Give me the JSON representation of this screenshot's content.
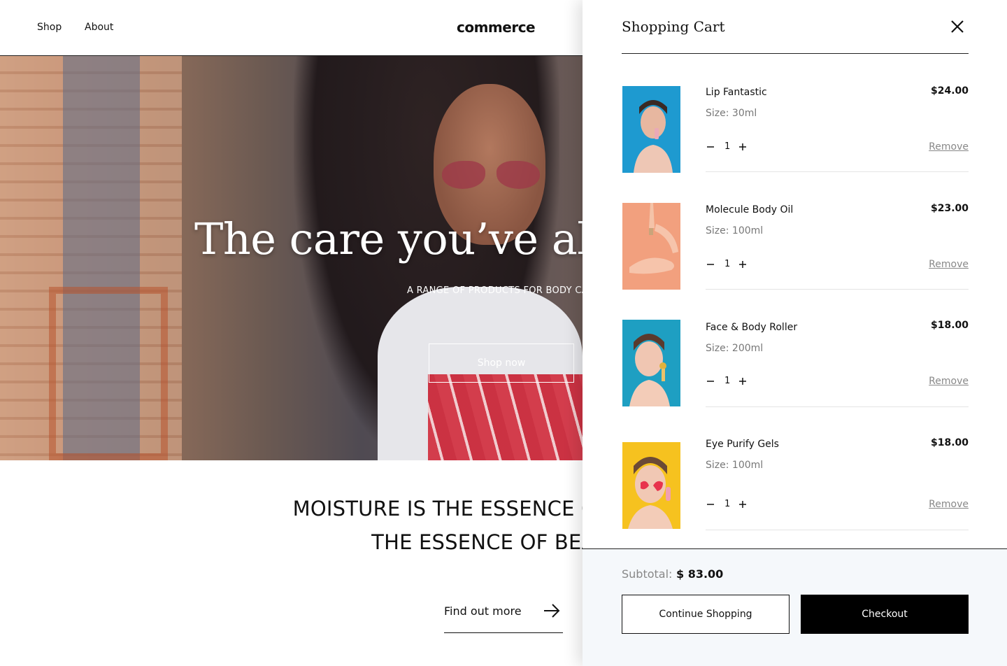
{
  "header": {
    "nav": [
      {
        "label": "Shop"
      },
      {
        "label": "About"
      }
    ],
    "logo": "commerce"
  },
  "hero": {
    "title": "The care you’ve always",
    "subtitle": "A RANGE OF PRODUCTS FOR BODY CARE",
    "cta_label": "Shop now"
  },
  "tagline": {
    "line1": "MOISTURE IS THE ESSENCE OF WETNESS",
    "line2": "THE ESSENCE OF BEAUTY"
  },
  "find_more": {
    "label": "Find out more",
    "icon": "arrow-right-icon"
  },
  "cart": {
    "title": "Shopping Cart",
    "close_icon": "close-icon",
    "items": [
      {
        "name": "Lip Fantastic",
        "size": "Size: 30ml",
        "price": "$24.00",
        "qty": "1",
        "remove_label": "Remove",
        "thumb_bg": "#1e9ad0"
      },
      {
        "name": "Molecule Body Oil",
        "size": "Size: 100ml",
        "price": "$23.00",
        "qty": "1",
        "remove_label": "Remove",
        "thumb_bg": "#f2a07e"
      },
      {
        "name": "Face & Body Roller",
        "size": "Size: 200ml",
        "price": "$18.00",
        "qty": "1",
        "remove_label": "Remove",
        "thumb_bg": "#1e9fc2"
      },
      {
        "name": "Eye Purify Gels",
        "size": "Size: 100ml",
        "price": "$18.00",
        "qty": "1",
        "remove_label": "Remove",
        "thumb_bg": "#f6c21f"
      }
    ],
    "subtotal_label": "Subtotal:",
    "subtotal_value": "$ 83.00",
    "continue_label": "Continue Shopping",
    "checkout_label": "Checkout"
  },
  "colors": {
    "accent": "#000000",
    "footer_bg": "#f5f8fb",
    "muted_text": "#777777"
  }
}
